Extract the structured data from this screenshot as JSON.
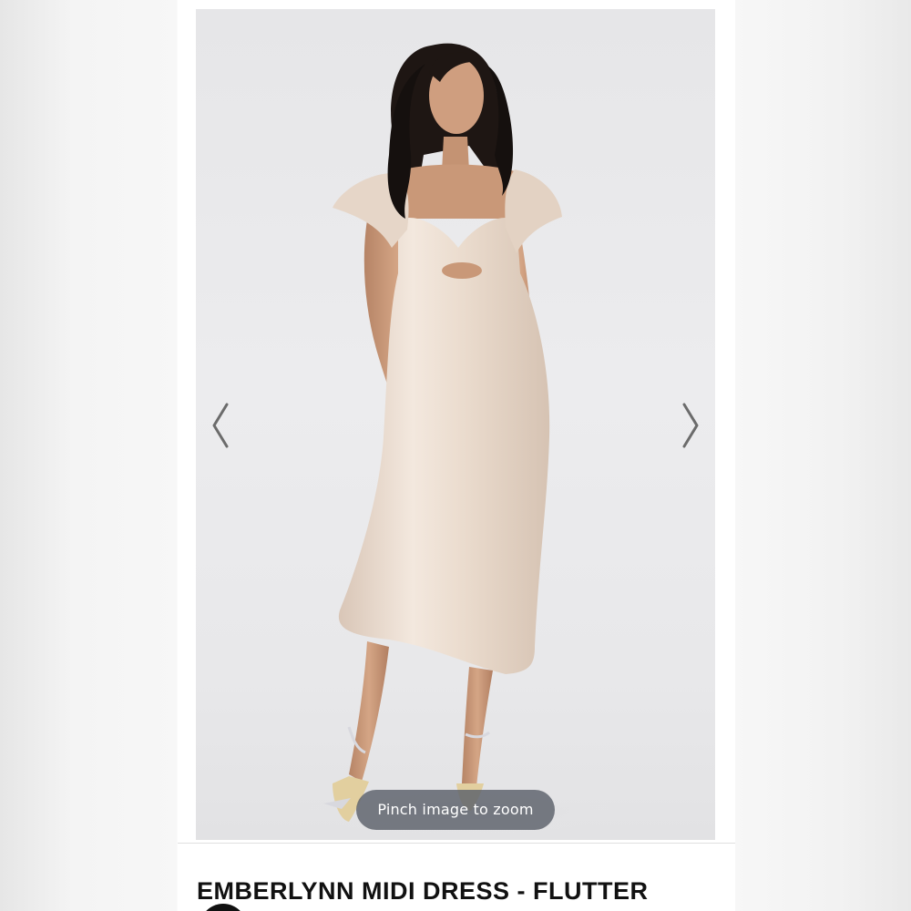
{
  "gallery": {
    "prev_arrow": "chevron-left-icon",
    "next_arrow": "chevron-right-icon",
    "zoom_hint": "Pinch image to zoom",
    "image_subject": "product-photo"
  },
  "product": {
    "title": "EMBERLYNN MIDI DRESS - FLUTTER"
  },
  "colors": {
    "dress": "#eadcd0",
    "backdrop": "#eaeaec",
    "chevron": "#6b6b6b",
    "title": "#111111"
  }
}
